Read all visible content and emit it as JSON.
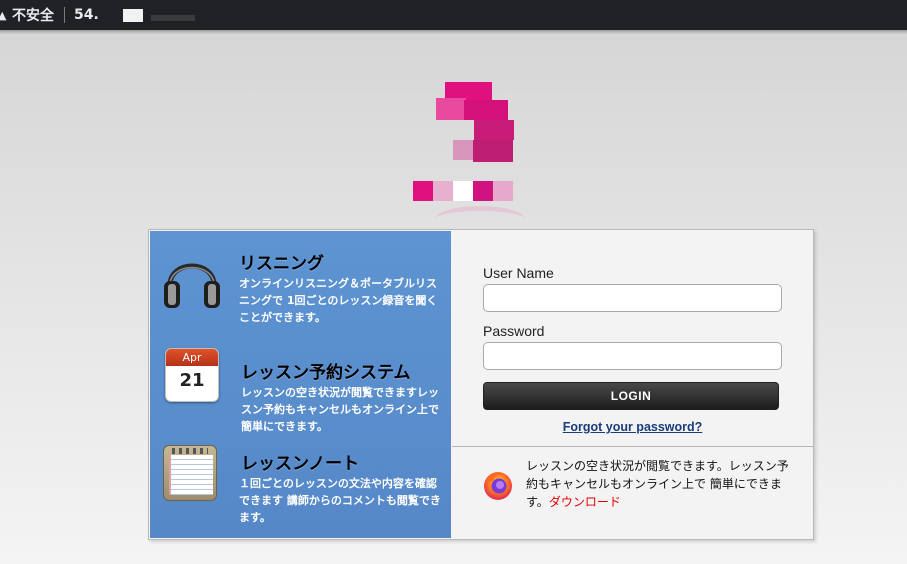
{
  "browser": {
    "security_label": "不安全",
    "url_prefix": "54."
  },
  "features": [
    {
      "title": "リスニング",
      "description": "オンラインリスニング＆ポータブルリスニングで 1回ごとのレッスン録音を聞くことができます。",
      "icon": "headphones-icon"
    },
    {
      "title": "レッスン予約システム",
      "calendar_month": "Apr",
      "calendar_day": "21",
      "description": "レッスンの空き状況が閲覧できますレッスン予約もキャンセルもオンライン上で 簡単にできます。",
      "icon": "calendar-icon"
    },
    {
      "title": "レッスンノート",
      "description": "１回ごとのレッスンの文法や内容を確認できます 講師からのコメントも閲覧できます。",
      "icon": "notepad-icon"
    }
  ],
  "login": {
    "username_label": "User Name",
    "username_value": "",
    "password_label": "Password",
    "password_value": "",
    "login_button": "LOGIN",
    "forgot_link": "Forgot your password?"
  },
  "download": {
    "text": "レッスンの空き状況が閲覧できます。レッスン予約もキャンセルもオンライン上で 簡単にできます。",
    "link": "ダウンロード",
    "icon": "firefox-icon"
  },
  "colors": {
    "feature_panel": "#5a8fd0",
    "brand_pink": "#e0117f",
    "link_blue": "#1a3c7a",
    "download_red": "#e00000"
  }
}
